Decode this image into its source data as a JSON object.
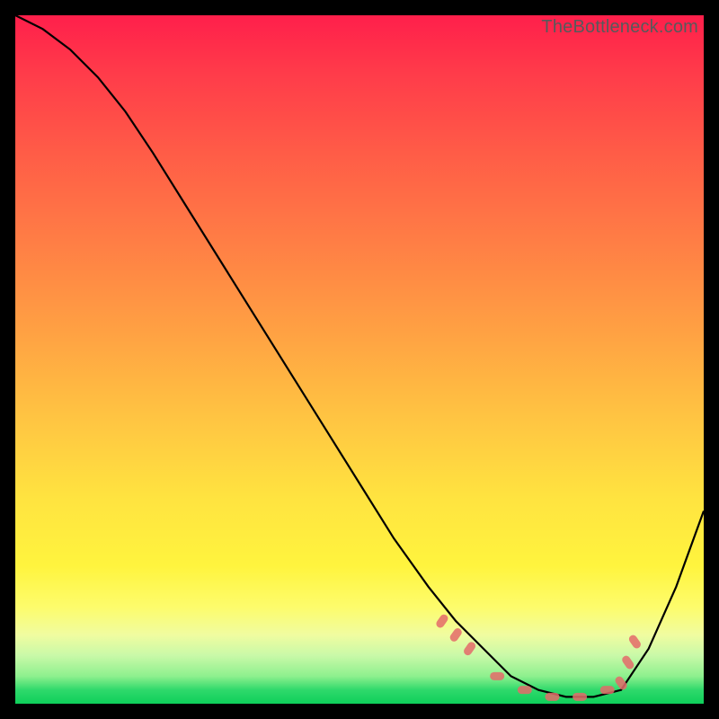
{
  "attribution": "TheBottleneck.com",
  "chart_data": {
    "type": "line",
    "title": "",
    "xlabel": "",
    "ylabel": "",
    "xlim": [
      0,
      100
    ],
    "ylim": [
      0,
      100
    ],
    "background_gradient": {
      "top": "#ff1f4b",
      "mid": "#ffe340",
      "bottom": "#0ecf5a"
    },
    "series": [
      {
        "name": "bottleneck-curve",
        "color": "#000000",
        "x": [
          0,
          4,
          8,
          12,
          16,
          20,
          25,
          30,
          35,
          40,
          45,
          50,
          55,
          60,
          64,
          68,
          72,
          76,
          80,
          84,
          88,
          92,
          96,
          100
        ],
        "values": [
          100,
          98,
          95,
          91,
          86,
          80,
          72,
          64,
          56,
          48,
          40,
          32,
          24,
          17,
          12,
          8,
          4,
          2,
          1,
          1,
          2,
          8,
          17,
          28
        ]
      }
    ],
    "markers": {
      "name": "bead-cluster",
      "color": "#e46a6a",
      "x": [
        62,
        64,
        66,
        70,
        74,
        78,
        82,
        86,
        88,
        89,
        90
      ],
      "values": [
        12,
        10,
        8,
        4,
        2,
        1,
        1,
        2,
        3,
        6,
        9
      ]
    }
  }
}
